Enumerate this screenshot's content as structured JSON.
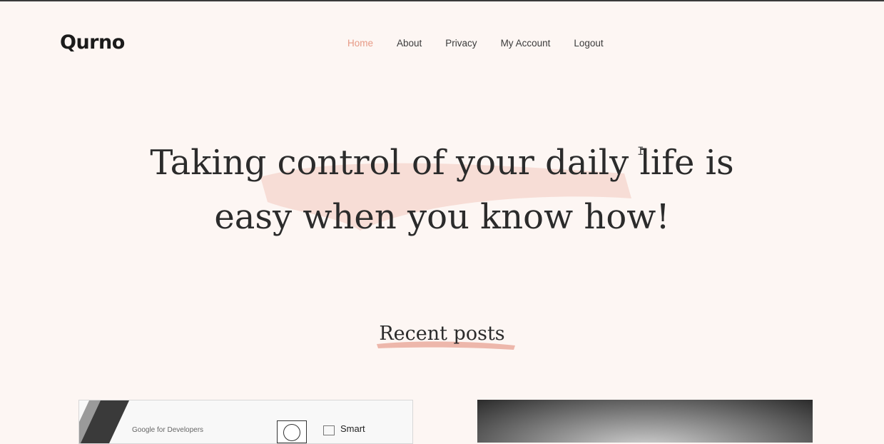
{
  "header": {
    "logo": "Qurno",
    "nav": [
      {
        "label": "Home",
        "active": true
      },
      {
        "label": "About",
        "active": false
      },
      {
        "label": "Privacy",
        "active": false
      },
      {
        "label": "My Account",
        "active": false
      },
      {
        "label": "Logout",
        "active": false
      }
    ]
  },
  "hero": {
    "title_line1": "Taking control of your daily life is",
    "title_line2": "easy when you know how!"
  },
  "recent": {
    "title": "Recent posts"
  },
  "posts": [
    {
      "image_texts": {
        "brand": "Google for Developers",
        "tag": "Smart"
      }
    },
    {
      "image_texts": {}
    }
  ],
  "colors": {
    "accent": "#e79a86",
    "background": "#fdf6f3",
    "text": "#2b2b2b",
    "brush": "#f2c9bd"
  },
  "icons": {
    "text-cursor": "I-beam"
  }
}
